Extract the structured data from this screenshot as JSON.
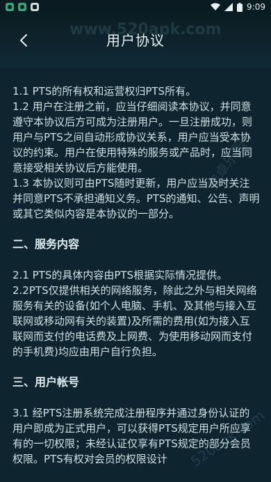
{
  "status_bar": {
    "time": "9:09",
    "icons": [
      "app-notification-icon",
      "app-notification-icon",
      "sim-icon",
      "wifi-icon",
      "signal-icon",
      "battery-icon"
    ]
  },
  "header": {
    "back_icon": "chevron-left-icon",
    "title": "用户协议"
  },
  "content": {
    "paragraphs_1": [
      "1.1 PTS的所有权和运营权归PTS所有。",
      "1.2 用户在注册之前，应当仔细阅读本协议，并同意遵守本协议后方可成为注册用户。一旦注册成功，则用户与PTS之间自动形成协议关系，用户应当受本协议的约束。用户在使用特殊的服务或产品时，应当同意接受相关协议后方能使用。",
      "1.3 本协议则可由PTS随时更新，用户应当及时关注并同意PTS不承担通知义务。PTS的通知、公告、声明或其它类似内容是本协议的一部分。"
    ],
    "section_2_title": "二、服务内容",
    "paragraphs_2": [
      "2.1 PTS的具体内容由PTS根据实际情况提供。",
      "2.2PTS仅提供相关的网络服务，除此之外与相关网络服务有关的设备(如个人电脑、手机、及其他与接入互联网或移动网有关的装置)及所需的费用(如为接入互联网而支付的电话费及上网费、为使用移动网而支付的手机费)均应由用户自行负担。"
    ],
    "section_3_title": "三、用户帐号",
    "paragraphs_3": [
      "3.1 经PTS注册系统完成注册程序并通过身份认证的用户即成为正式用户，可以获得PTS规定用户所应享有的一切权限；未经认证仅享有PTS规定的部分会员权限。PTS有权对会员的权限设计"
    ]
  },
  "watermarks": [
    "www.520apk.com",
    "安卓乐园",
    "520apk.com"
  ]
}
